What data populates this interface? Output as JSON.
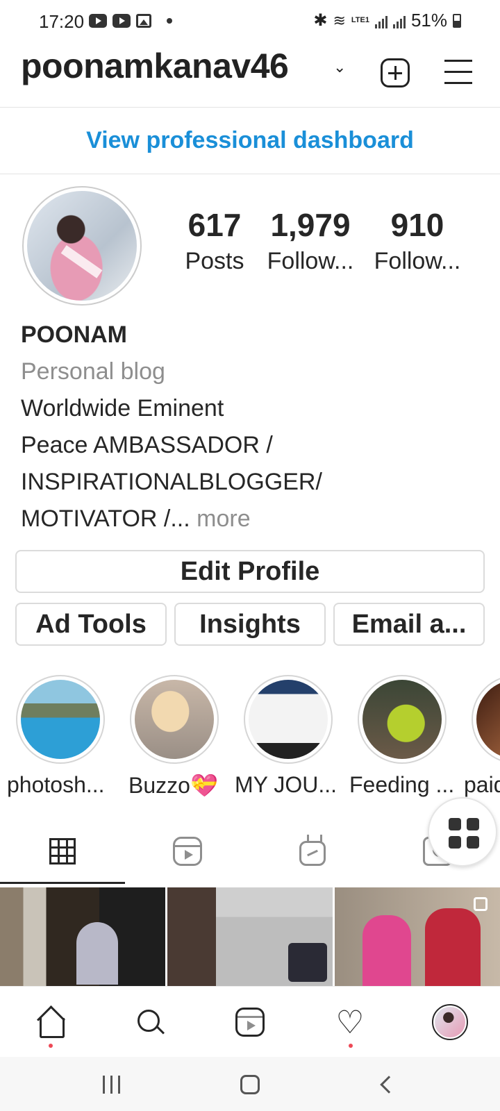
{
  "status_bar": {
    "time": "17:20",
    "network": "LTE1",
    "battery": "51%"
  },
  "header": {
    "username": "poonamkanav46",
    "icons": [
      "chevron-down-icon",
      "new-post-icon",
      "menu-icon"
    ]
  },
  "dashboard": {
    "label": "View professional dashboard"
  },
  "profile": {
    "stats": {
      "posts_count": "617",
      "posts_label": "Posts",
      "followers_count": "1,979",
      "followers_label": "Follow...",
      "following_count": "910",
      "following_label": "Follow..."
    },
    "bio": {
      "name": "POONAM",
      "category": "Personal blog",
      "line1": "Worldwide Eminent",
      "line2": "Peace AMBASSADOR /",
      "line3": "INSPIRATIONALBLOGGER/",
      "line4": "MOTIVATOR /...",
      "more": "more"
    }
  },
  "buttons": {
    "edit_profile": "Edit Profile",
    "ad_tools": "Ad Tools",
    "insights": "Insights",
    "email": "Email a..."
  },
  "highlights": [
    {
      "label": "photosh..."
    },
    {
      "label": "Buzzo💝"
    },
    {
      "label": "MY JOU..."
    },
    {
      "label": "Feeding ..."
    },
    {
      "label": "paid"
    }
  ],
  "tabs": [
    "grid-icon",
    "reels-icon",
    "igtv-icon",
    "tagged-icon"
  ],
  "bottom_nav": [
    "home-icon",
    "search-icon",
    "reels-icon",
    "heart-icon",
    "profile-avatar"
  ],
  "colors": {
    "link_blue": "#1a8fd8",
    "text": "#262626",
    "muted": "#8e8e8e",
    "notification_dot": "#ed4956"
  }
}
